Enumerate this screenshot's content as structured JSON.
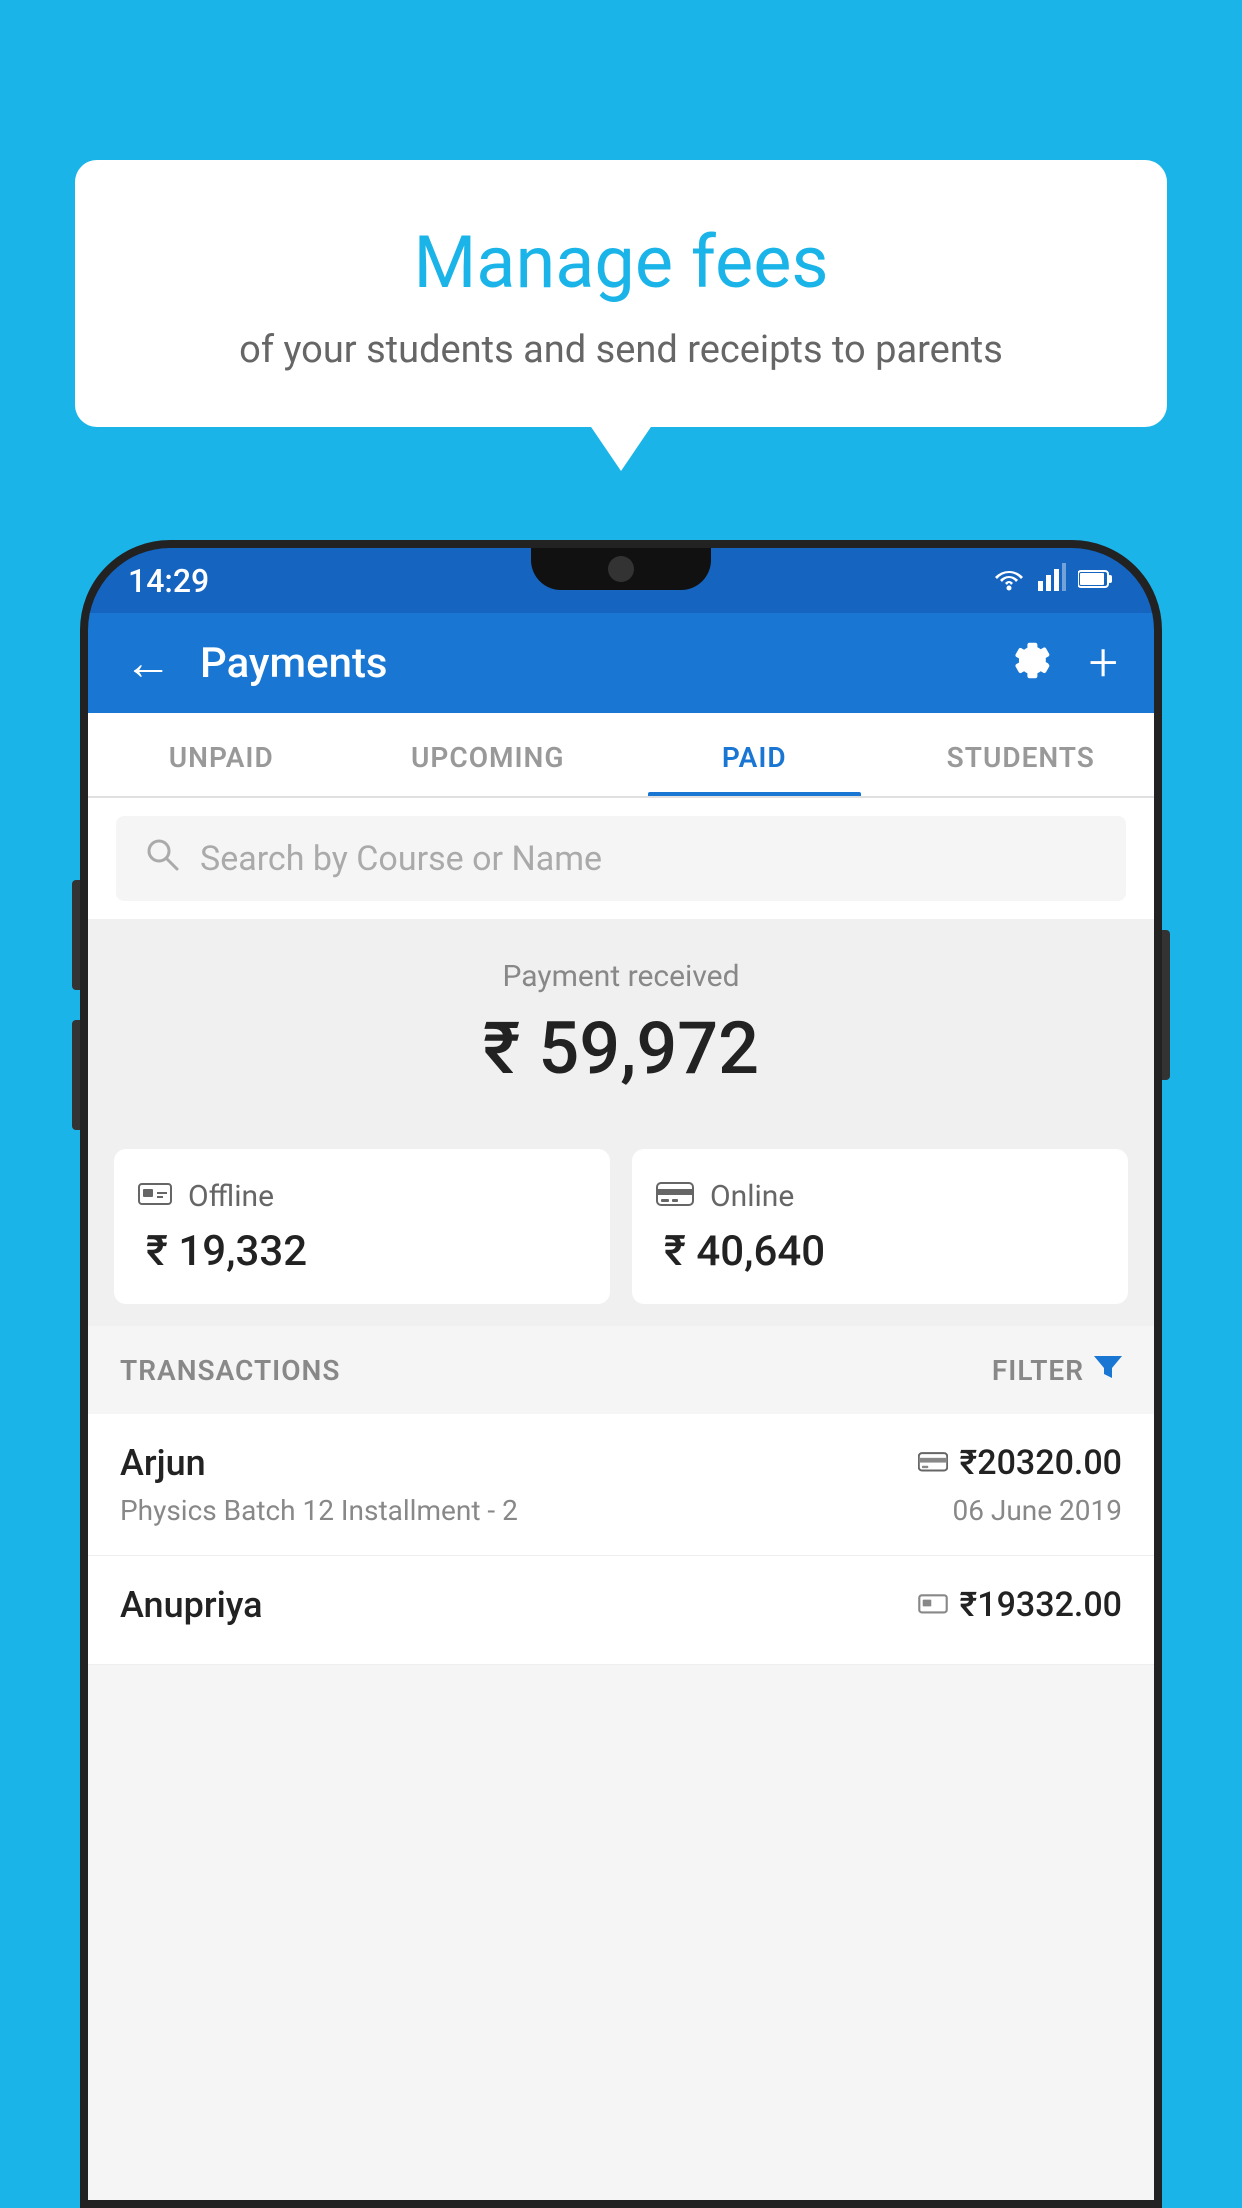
{
  "background_color": "#1ab4e8",
  "tooltip": {
    "title": "Manage fees",
    "subtitle": "of your students and send receipts to parents"
  },
  "status_bar": {
    "time": "14:29",
    "icons": [
      "wifi",
      "signal",
      "battery"
    ]
  },
  "app_bar": {
    "title": "Payments",
    "back_label": "←",
    "settings_icon": "gear-icon",
    "add_icon": "plus-icon"
  },
  "tabs": [
    {
      "id": "unpaid",
      "label": "UNPAID",
      "active": false
    },
    {
      "id": "upcoming",
      "label": "UPCOMING",
      "active": false
    },
    {
      "id": "paid",
      "label": "PAID",
      "active": true
    },
    {
      "id": "students",
      "label": "STUDENTS",
      "active": false
    }
  ],
  "search": {
    "placeholder": "Search by Course or Name"
  },
  "payment_summary": {
    "label": "Payment received",
    "amount": "₹ 59,972"
  },
  "payment_methods": [
    {
      "type": "Offline",
      "amount": "₹ 19,332",
      "icon": "offline"
    },
    {
      "type": "Online",
      "amount": "₹ 40,640",
      "icon": "online"
    }
  ],
  "transactions_label": "TRANSACTIONS",
  "filter_label": "FILTER",
  "transactions": [
    {
      "name": "Arjun",
      "detail": "Physics Batch 12 Installment - 2",
      "amount": "₹20320.00",
      "date": "06 June 2019",
      "payment_type": "online"
    },
    {
      "name": "Anupriya",
      "detail": "",
      "amount": "₹19332.00",
      "date": "",
      "payment_type": "offline"
    }
  ]
}
